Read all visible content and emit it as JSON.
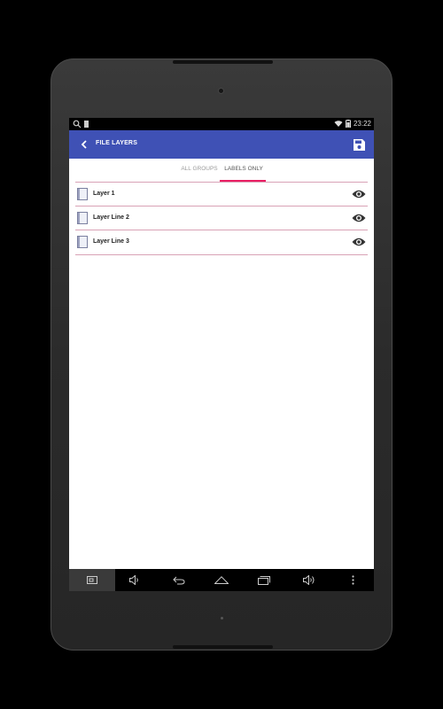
{
  "status_bar": {
    "time": "23:22",
    "icons": [
      "search-icon",
      "sd-card-icon",
      "wifi-icon",
      "battery-icon"
    ]
  },
  "app_bar": {
    "title": "FILE LAYERS",
    "back_icon": "chevron-left-icon",
    "save_icon": "floppy-disk-icon",
    "color": "#3f51b5"
  },
  "tabs": [
    {
      "label": "ALL GROUPS",
      "active": false
    },
    {
      "label": "LABELS ONLY",
      "active": true
    }
  ],
  "tab_indicator_color": "#e91e63",
  "layers": [
    {
      "name": "Layer 1",
      "icon": "document-icon",
      "visible": true
    },
    {
      "name": "Layer Line 2",
      "icon": "document-icon",
      "visible": true
    },
    {
      "name": "Layer Line 3",
      "icon": "document-icon",
      "visible": true
    }
  ],
  "nav_bar": {
    "items": [
      "screenshot-icon",
      "volume-down-icon",
      "back-icon",
      "home-icon",
      "recents-icon",
      "volume-up-icon",
      "overflow-menu-icon"
    ]
  }
}
